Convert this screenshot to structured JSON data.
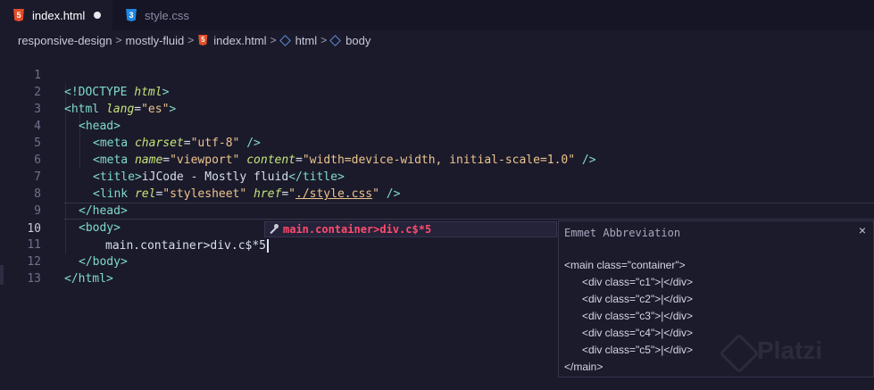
{
  "tabs": [
    {
      "label": "index.html",
      "icon": "html5-icon",
      "active": true,
      "unsaved": true
    },
    {
      "label": "style.css",
      "icon": "css3-icon",
      "active": false
    }
  ],
  "breadcrumb": [
    "responsive-design",
    "mostly-fluid",
    "index.html",
    "html",
    "body"
  ],
  "line_numbers": [
    "1",
    "2",
    "3",
    "4",
    "5",
    "6",
    "7",
    "8",
    "9",
    "10",
    "11",
    "12",
    "13"
  ],
  "code": {
    "l1_a": "<!DOCTYPE ",
    "l1_b": "html",
    "l1_c": ">",
    "l2_a": "<html ",
    "l2_b": "lang",
    "l2_c": "=",
    "l2_d": "\"es\"",
    "l2_e": ">",
    "l3": "<head>",
    "l4_a": "<meta ",
    "l4_b": "charset",
    "l4_c": "=",
    "l4_d": "\"utf-8\"",
    "l4_e": " />",
    "l5_a": "<meta ",
    "l5_b": "name",
    "l5_c": "=",
    "l5_d": "\"viewport\"",
    "l5_e": " ",
    "l5_f": "content",
    "l5_g": "=",
    "l5_h": "\"width=device-width, initial-scale=1.0\"",
    "l5_i": " />",
    "l6_a": "<title>",
    "l6_b": "iJCode - Mostly fluid",
    "l6_c": "</title>",
    "l7_a": "<link ",
    "l7_b": "rel",
    "l7_c": "=",
    "l7_d": "\"stylesheet\"",
    "l7_e": " ",
    "l7_f": "href",
    "l7_g": "=",
    "l7_h": "\"",
    "l7_i": "./style.css",
    "l7_j": "\"",
    "l7_k": " />",
    "l8": "</head>",
    "l9": "<body>",
    "l10": "main.container>div.c$*5",
    "l11": "</body>",
    "l12": "</html>"
  },
  "suggestion": {
    "text": "main.container>div.c$*5"
  },
  "emmet_panel": {
    "title": "Emmet Abbreviation",
    "close": "×",
    "lines": [
      "<main class=\"container\">",
      "      <div class=\"c1\">|</div>",
      "      <div class=\"c2\">|</div>",
      "      <div class=\"c3\">|</div>",
      "      <div class=\"c4\">|</div>",
      "      <div class=\"c5\">|</div>",
      "</main>"
    ]
  },
  "watermark": "Platzi",
  "colors": {
    "tag": "#7fdbca",
    "attribute": "#c5e478",
    "string": "#ecc48d",
    "suggestion": "#ff4b6e",
    "background": "#1b1a2b"
  }
}
